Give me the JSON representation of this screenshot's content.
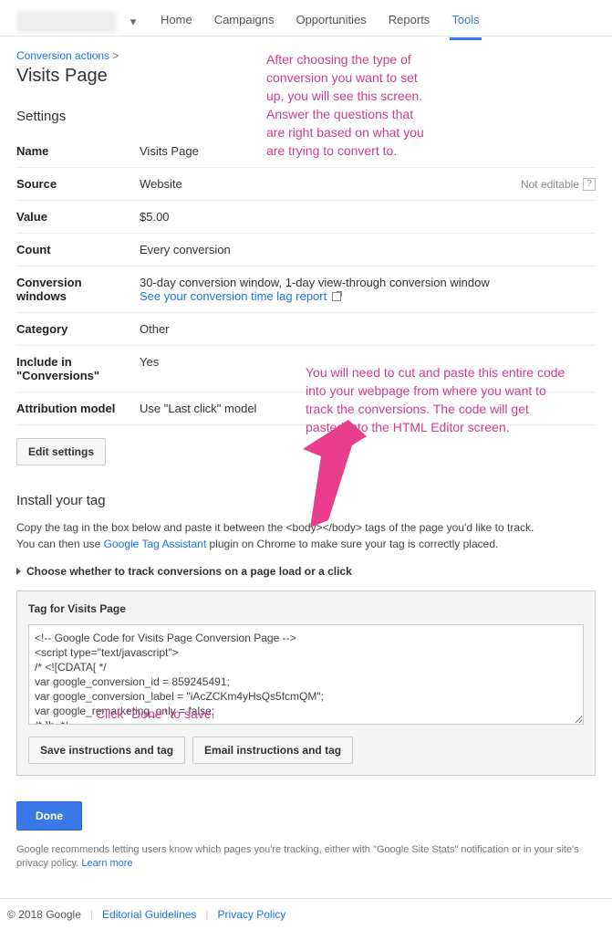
{
  "nav": {
    "items": [
      "Home",
      "Campaigns",
      "Opportunities",
      "Reports",
      "Tools"
    ],
    "active_index": 4
  },
  "breadcrumb": {
    "link": "Conversion actions",
    "sep": ">"
  },
  "page_title": "Visits Page",
  "settings": {
    "heading": "Settings",
    "rows": {
      "name": {
        "label": "Name",
        "value": "Visits Page"
      },
      "source": {
        "label": "Source",
        "value": "Website",
        "not_editable": "Not editable"
      },
      "value": {
        "label": "Value",
        "value": "$5.00"
      },
      "count": {
        "label": "Count",
        "value": "Every conversion"
      },
      "windows": {
        "label": "Conversion windows",
        "value": "30-day conversion window, 1-day view-through conversion window",
        "link": "See your conversion time lag report"
      },
      "category": {
        "label": "Category",
        "value": "Other"
      },
      "include": {
        "label": "Include in \"Conversions\"",
        "value": "Yes"
      },
      "attr": {
        "label": "Attribution model",
        "value": "Use \"Last click\" model"
      }
    },
    "edit_button": "Edit settings"
  },
  "install": {
    "heading": "Install your tag",
    "desc_1": "Copy the tag in the box below and paste it between the <body></body> tags of the page you'd like to track.",
    "desc_2a": "You can then use ",
    "desc_2_link": "Google Tag Assistant",
    "desc_2b": " plugin on Chrome to make sure your tag is correctly placed.",
    "disclosure": "Choose whether to track conversions on a page load or a click",
    "panel_title": "Tag for Visits Page",
    "code": "<!-- Google Code for Visits Page Conversion Page -->\n<script type=\"text/javascript\">\n/* <![CDATA[ */\nvar google_conversion_id = 859245491;\nvar google_conversion_label = \"iAcZCKm4yHsQs5fcmQM\";\nvar google_remarketing_only = false;\n/* ]]> */\n</script>",
    "save_button": "Save instructions and tag",
    "email_button": "Email instructions and tag"
  },
  "done_button": "Done",
  "recommend": {
    "text": "Google recommends letting users know which pages you're tracking, either with \"Google Site Stats\" notification or in your site's privacy policy. ",
    "link": "Learn more"
  },
  "footer": {
    "copyright": "© 2018 Google",
    "links": [
      "Editorial Guidelines",
      "Privacy Policy"
    ]
  },
  "annotations": {
    "top": "After choosing the type of\nconversion you want to set\nup, you will see this screen.\nAnswer the questions that\nare right based on what you\nare trying to convert to.",
    "mid": "You will need to cut and paste this entire code\ninto your webpage from where you want to\ntrack the conversions.  The code will get\npasted into the HTML Editor screen.",
    "done": "Click \"Done\" to save."
  }
}
